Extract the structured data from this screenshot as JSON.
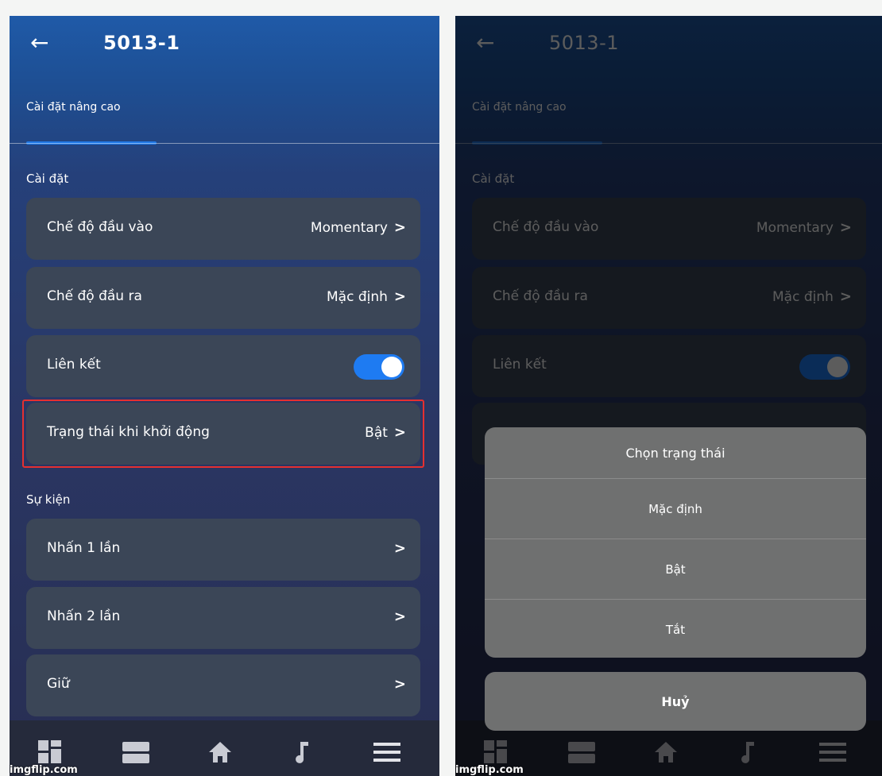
{
  "left_screen": {
    "header": {
      "back_icon": "arrow-left-icon",
      "title": "5013-1"
    },
    "tab": {
      "label": "Cài đặt nâng cao"
    },
    "settings_section": {
      "title": "Cài đặt",
      "rows": [
        {
          "label": "Chế độ đầu vào",
          "value": "Momentary"
        },
        {
          "label": "Chế độ đầu ra",
          "value": "Mặc định"
        },
        {
          "label": "Liên kết",
          "toggle_on": true
        },
        {
          "label": "Trạng thái khi khởi động",
          "value": "Bật",
          "highlighted": true
        }
      ]
    },
    "events_section": {
      "title": "Sự kiện",
      "rows": [
        {
          "label": "Nhấn 1 lần"
        },
        {
          "label": "Nhấn 2 lần"
        },
        {
          "label": "Giữ"
        }
      ]
    },
    "navbar_icons": [
      "dashboard-icon",
      "rooms-icon",
      "home-icon",
      "music-icon",
      "menu-icon"
    ],
    "watermark": "imgflip.com"
  },
  "right_screen": {
    "dialog": {
      "title": "Chọn trạng thái",
      "options": [
        "Mặc định",
        "Bật",
        "Tắt"
      ],
      "cancel_label": "Huỷ"
    },
    "watermark": "imgflip.com"
  },
  "colors": {
    "accent": "#1e7bf2",
    "row_background": "#3b4657",
    "highlight_border": "#e53030",
    "dialog_background": "#6f7070"
  },
  "chevron": "›"
}
